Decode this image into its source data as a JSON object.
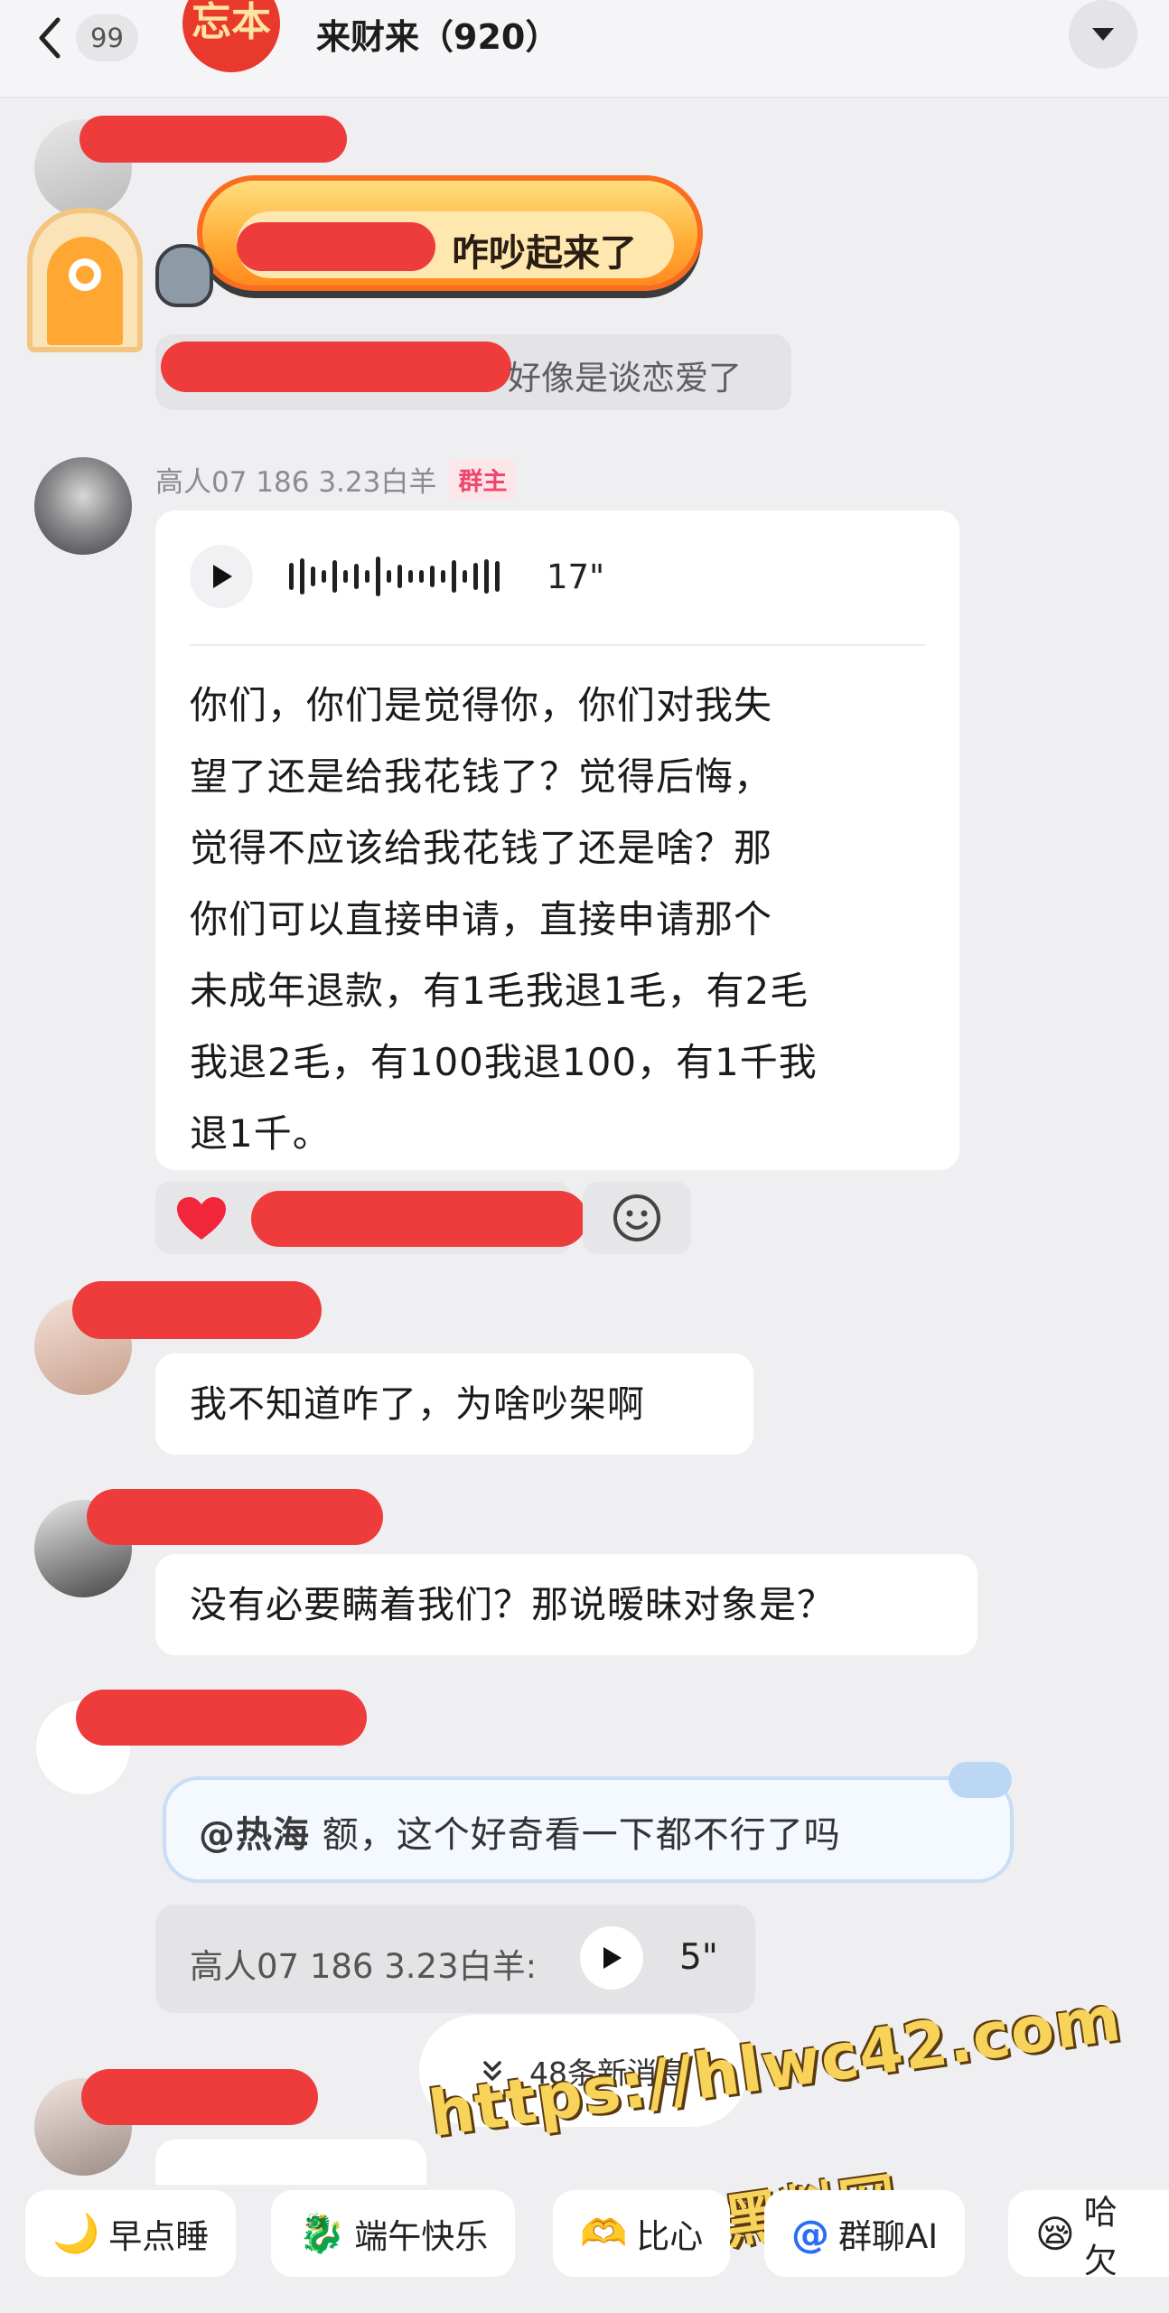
{
  "header": {
    "unread_count": "99",
    "group_avatar_text": "忘本",
    "group_title": "来财来（920）"
  },
  "banner": {
    "suffix": "咋吵起来了"
  },
  "tip": {
    "text": "好像是谈恋爱了"
  },
  "owner_message": {
    "sender_name": "高人07  186  3.23白羊",
    "role_badge": "群主",
    "voice_duration": "17\"",
    "transcript_lines": [
      "你们，你们是觉得你，你们对我失",
      "望了还是给我花钱了？觉得后悔，",
      "觉得不应该给我花钱了还是啥？那",
      "你们可以直接申请，直接申请那个",
      "未成年退款，有1毛我退1毛，有2毛",
      "我退2毛，有100我退100，有1千我",
      "退1千。"
    ]
  },
  "messages": [
    {
      "text": "我不知道咋了，为啥吵架啊"
    },
    {
      "text": "没有必要瞒着我们？那说暧昧对象是？"
    }
  ],
  "reply": {
    "mention": "@热海",
    "text": " 额，这个好奇看一下都不行了吗"
  },
  "quote_voice": {
    "label": "高人07  186  3.23白羊:",
    "duration": "5\""
  },
  "new_messages": {
    "label": "48条新消息"
  },
  "watermark": {
    "url": "https://hlwc42.com",
    "name": "黑料网"
  },
  "quick_chips": [
    {
      "icon": "moon-icon",
      "glyph": "🌙",
      "label": "早点睡"
    },
    {
      "icon": "dragon-icon",
      "glyph": "🐉",
      "label": "端午快乐"
    },
    {
      "icon": "heart-hands-icon",
      "glyph": "🫶",
      "label": "比心"
    },
    {
      "icon": "at-icon",
      "glyph": "@",
      "label": "群聊AI"
    },
    {
      "icon": "yawn-icon",
      "glyph": "😪",
      "label": "哈欠"
    }
  ],
  "colors": {
    "redaction": "#ee3b3b",
    "owner_badge": "#f0466e",
    "background": "#efeff1"
  }
}
